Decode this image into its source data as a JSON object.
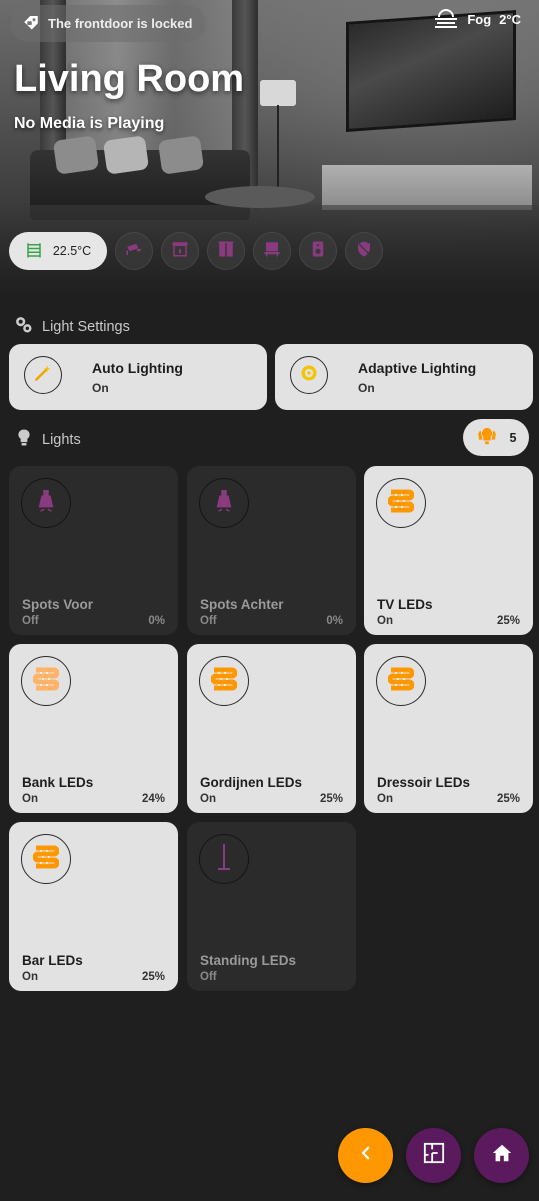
{
  "header": {
    "lock_status": "The frontdoor is locked",
    "weather_condition": "Fog",
    "weather_temp": "2°C",
    "room_title": "Living Room",
    "media_status": "No Media is Playing",
    "temperature": "22.5°C"
  },
  "badges": [
    "camera-icon",
    "fireplace-icon",
    "curtains-icon",
    "tv-stand-icon",
    "speaker-icon",
    "security-shield-icon"
  ],
  "light_settings": {
    "heading": "Light Settings",
    "cards": [
      {
        "name": "Auto Lighting",
        "state": "On"
      },
      {
        "name": "Adaptive Lighting",
        "state": "On"
      }
    ]
  },
  "lights": {
    "heading": "Lights",
    "on_count": "5",
    "tiles": [
      {
        "name": "Spots Voor",
        "state": "Off",
        "pct": "0%"
      },
      {
        "name": "Spots Achter",
        "state": "Off",
        "pct": "0%"
      },
      {
        "name": "TV LEDs",
        "state": "On",
        "pct": "25%"
      },
      {
        "name": "Bank LEDs",
        "state": "On",
        "pct": "24%"
      },
      {
        "name": "Gordijnen LEDs",
        "state": "On",
        "pct": "25%"
      },
      {
        "name": "Dressoir LEDs",
        "state": "On",
        "pct": "25%"
      },
      {
        "name": "Bar LEDs",
        "state": "On",
        "pct": "25%"
      },
      {
        "name": "Standing LEDs",
        "state": "Off"
      }
    ]
  },
  "colors": {
    "accent_orange": "#ff9800",
    "accent_purple": "#5b1a5e",
    "icon_off_purple": "#8a3a7e",
    "on_tile_bg": "#e2e2e2",
    "off_tile_bg": "#2b2b2b",
    "page_bg": "#1f1f1f"
  }
}
